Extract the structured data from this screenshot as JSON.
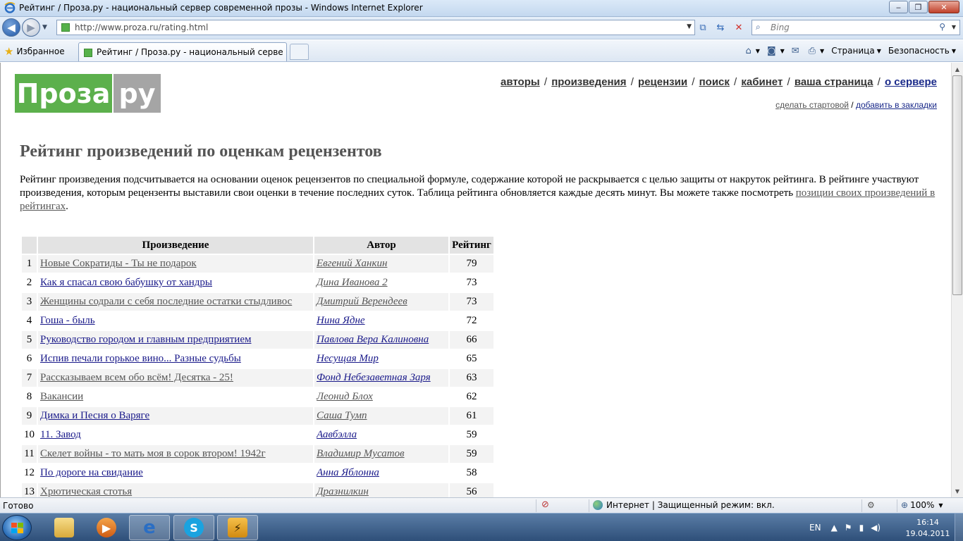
{
  "window": {
    "title": "Рейтинг / Проза.ру - национальный сервер современной прозы - Windows Internet Explorer",
    "minimize_glyph": "‒",
    "maximize_glyph": "❐",
    "close_glyph": "✕"
  },
  "address_bar": {
    "url": "http://www.proza.ru/rating.html",
    "search_placeholder": "Bing"
  },
  "favorites": {
    "label": "Избранное"
  },
  "tabs": [
    {
      "label": "Рейтинг / Проза.ру - национальный сервер со..."
    }
  ],
  "command_bar": {
    "page_label": "Страница",
    "safety_label": "Безопасность"
  },
  "site": {
    "logo_part1": "Проза",
    "logo_part2": "ру",
    "nav": [
      {
        "label": "авторы"
      },
      {
        "label": "произведения"
      },
      {
        "label": "рецензии"
      },
      {
        "label": "поиск"
      },
      {
        "label": "кабинет"
      },
      {
        "label": "ваша страница"
      },
      {
        "label": "о сервере"
      }
    ],
    "subnav": {
      "make_home": "сделать стартовой",
      "bookmark": "добавить в закладки"
    }
  },
  "page": {
    "title": "Рейтинг произведений по оценкам рецензентов",
    "intro_text": "Рейтинг произведения подсчитывается на основании оценок рецензентов по специальной формуле, содержание которой не раскрывается с целью защиты от накруток рейтинга. В рейтинге участвуют произведения, которым рецензенты выставили свои оценки в течение последних суток. Таблица рейтинга обновляется каждые десять минут. Вы можете также посмотреть ",
    "intro_link": "позиции своих произведений в рейтингах",
    "intro_end": "."
  },
  "table": {
    "headers": {
      "num": "",
      "work": "Произведение",
      "author": "Автор",
      "rating": "Рейтинг"
    },
    "rows": [
      {
        "num": "1",
        "work": "Новые Сократиды - Ты не подарок",
        "author": "Евгений Ханкин",
        "rating": "79",
        "work_style": "v",
        "author_style": "v"
      },
      {
        "num": "2",
        "work": "Как я спасал свою бабушку от хандры",
        "author": "Дина Иванова 2",
        "rating": "73",
        "work_style": "u",
        "author_style": "v"
      },
      {
        "num": "3",
        "work": "Женщины содрали с себя последние остатки стыдливос",
        "author": "Дмитрий Верендеев",
        "rating": "73",
        "work_style": "v",
        "author_style": "v"
      },
      {
        "num": "4",
        "work": "Гоша - быль",
        "author": "Нина Ядне",
        "rating": "72",
        "work_style": "u",
        "author_style": "u"
      },
      {
        "num": "5",
        "work": "Руководство городом и главным предприятием",
        "author": "Павлова Вера Калиновна",
        "rating": "66",
        "work_style": "u",
        "author_style": "u"
      },
      {
        "num": "6",
        "work": "Испив печали горькое вино... Разные судьбы",
        "author": "Несущая Мир",
        "rating": "65",
        "work_style": "u",
        "author_style": "u"
      },
      {
        "num": "7",
        "work": "Рассказываем всем обо всём! Десятка - 25!",
        "author": "Фонд Небезаветная Заря",
        "rating": "63",
        "work_style": "v",
        "author_style": "u"
      },
      {
        "num": "8",
        "work": "Вакансии",
        "author": "Леонид Блох",
        "rating": "62",
        "work_style": "v",
        "author_style": "v"
      },
      {
        "num": "9",
        "work": "Димка и Песня о Варяге",
        "author": "Саша Тумп",
        "rating": "61",
        "work_style": "u",
        "author_style": "v"
      },
      {
        "num": "10",
        "work": "11. Завод",
        "author": "Аавбэлла",
        "rating": "59",
        "work_style": "u",
        "author_style": "u"
      },
      {
        "num": "11",
        "work": "Скелет войны - то мать моя в сорок втором! 1942г",
        "author": "Владимир Мусатов",
        "rating": "59",
        "work_style": "v",
        "author_style": "v"
      },
      {
        "num": "12",
        "work": "По дороге на свидание",
        "author": "Анна Яблонна",
        "rating": "58",
        "work_style": "u",
        "author_style": "u"
      },
      {
        "num": "13",
        "work": "Хрютическая стотья",
        "author": "Дразнилкин",
        "rating": "56",
        "work_style": "v",
        "author_style": "v"
      }
    ]
  },
  "status_bar": {
    "ready": "Готово",
    "zone": "Интернет | Защищенный режим: вкл.",
    "zoom": "100%"
  },
  "taskbar": {
    "lang": "EN",
    "time": "16:14",
    "date": "19.04.2011"
  },
  "colors": {
    "logo_green": "#5cb04c",
    "logo_gray": "#a5a5a5",
    "visited_link": "#555555",
    "unvisited_link": "#1a1a8a"
  }
}
